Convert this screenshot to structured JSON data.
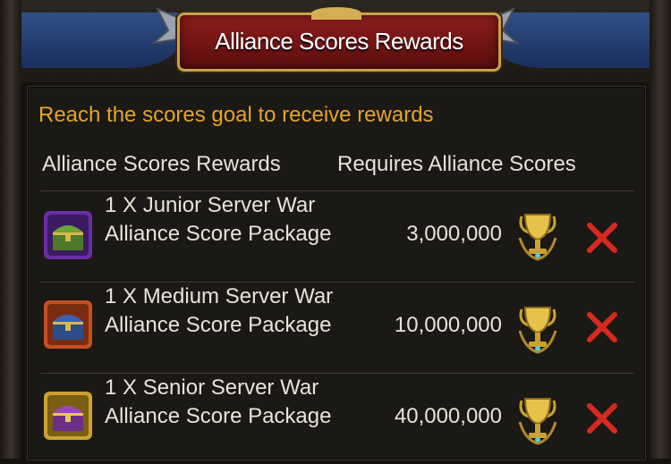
{
  "header": {
    "title": "Alliance Scores Rewards"
  },
  "panel": {
    "subtitle": "Reach the scores goal to receive rewards",
    "columns": {
      "reward": "Alliance Scores Rewards",
      "requires": "Requires Alliance Scores"
    },
    "rows": [
      {
        "name": "1 X Junior Server War Alliance Score Package",
        "score": "3,000,000",
        "icon": "green-chest-icon",
        "frame_color": "#7b3bb5",
        "status": "not-achieved"
      },
      {
        "name": "1 X Medium Server War Alliance Score Package",
        "score": "10,000,000",
        "icon": "blue-chest-icon",
        "frame_color": "#c2501f",
        "status": "not-achieved"
      },
      {
        "name": "1 X Senior Server War Alliance Score Package",
        "score": "40,000,000",
        "icon": "purple-chest-icon",
        "frame_color": "#c9a233",
        "status": "not-achieved"
      }
    ]
  },
  "colors": {
    "subtitle": "#e5a428",
    "text": "#e8e3d8",
    "title_plate": "#8c1e1c",
    "x_mark": "#d42a1f"
  }
}
